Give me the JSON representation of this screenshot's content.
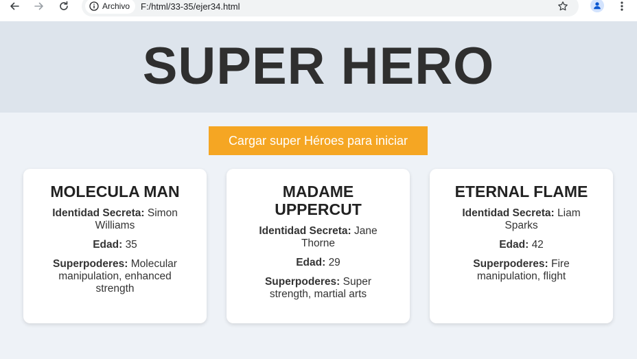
{
  "browser": {
    "chip_label": "Archivo",
    "url": "F:/html/33-35/ejer34.html"
  },
  "page": {
    "title": "SUPER HERO",
    "load_button": "Cargar super Héroes para iniciar"
  },
  "labels": {
    "identity": "Identidad Secreta:",
    "age": "Edad:",
    "powers": "Superpoderes:"
  },
  "heroes": [
    {
      "name": "MOLECULA MAN",
      "identity": "Simon Williams",
      "age": "35",
      "powers": "Molecular manipulation, enhanced strength"
    },
    {
      "name": "MADAME UPPERCUT",
      "identity": "Jane Thorne",
      "age": "29",
      "powers": "Super strength, martial arts"
    },
    {
      "name": "ETERNAL FLAME",
      "identity": "Liam Sparks",
      "age": "42",
      "powers": "Fire manipulation, flight"
    }
  ]
}
